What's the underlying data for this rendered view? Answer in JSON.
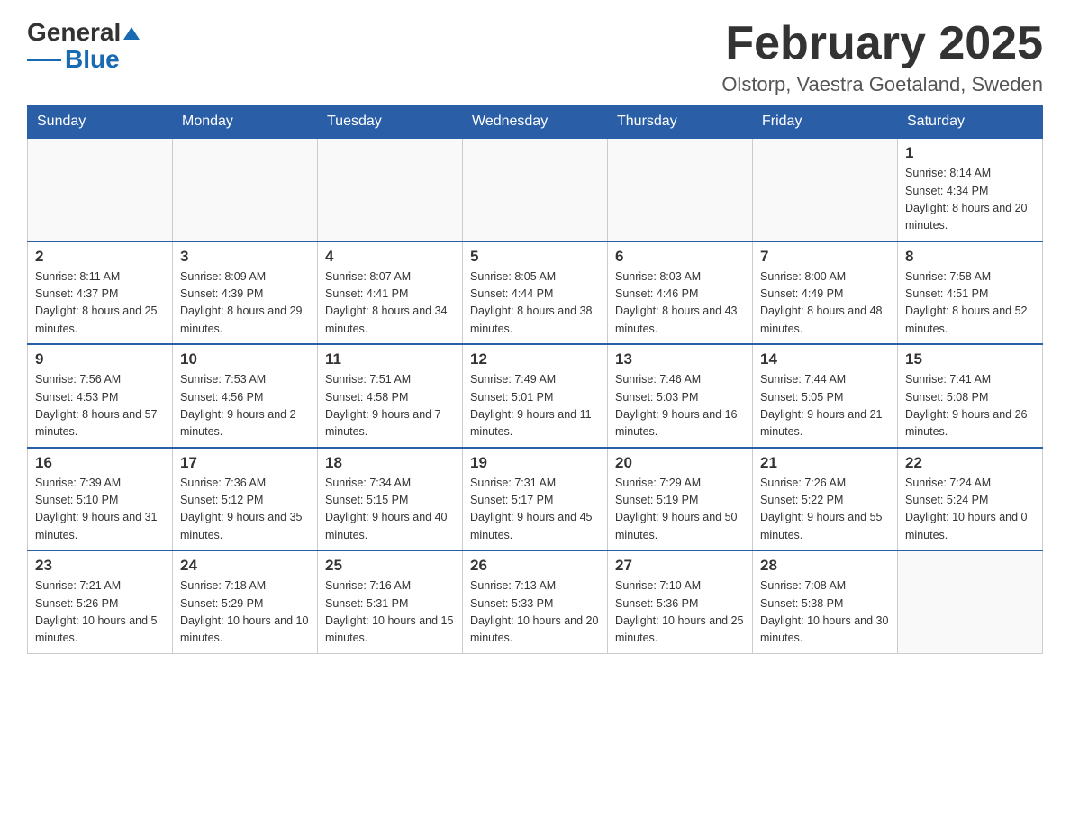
{
  "logo": {
    "general": "General",
    "blue": "Blue"
  },
  "header": {
    "title": "February 2025",
    "location": "Olstorp, Vaestra Goetaland, Sweden"
  },
  "weekdays": [
    "Sunday",
    "Monday",
    "Tuesday",
    "Wednesday",
    "Thursday",
    "Friday",
    "Saturday"
  ],
  "weeks": [
    [
      {
        "day": "",
        "info": ""
      },
      {
        "day": "",
        "info": ""
      },
      {
        "day": "",
        "info": ""
      },
      {
        "day": "",
        "info": ""
      },
      {
        "day": "",
        "info": ""
      },
      {
        "day": "",
        "info": ""
      },
      {
        "day": "1",
        "info": "Sunrise: 8:14 AM\nSunset: 4:34 PM\nDaylight: 8 hours and 20 minutes."
      }
    ],
    [
      {
        "day": "2",
        "info": "Sunrise: 8:11 AM\nSunset: 4:37 PM\nDaylight: 8 hours and 25 minutes."
      },
      {
        "day": "3",
        "info": "Sunrise: 8:09 AM\nSunset: 4:39 PM\nDaylight: 8 hours and 29 minutes."
      },
      {
        "day": "4",
        "info": "Sunrise: 8:07 AM\nSunset: 4:41 PM\nDaylight: 8 hours and 34 minutes."
      },
      {
        "day": "5",
        "info": "Sunrise: 8:05 AM\nSunset: 4:44 PM\nDaylight: 8 hours and 38 minutes."
      },
      {
        "day": "6",
        "info": "Sunrise: 8:03 AM\nSunset: 4:46 PM\nDaylight: 8 hours and 43 minutes."
      },
      {
        "day": "7",
        "info": "Sunrise: 8:00 AM\nSunset: 4:49 PM\nDaylight: 8 hours and 48 minutes."
      },
      {
        "day": "8",
        "info": "Sunrise: 7:58 AM\nSunset: 4:51 PM\nDaylight: 8 hours and 52 minutes."
      }
    ],
    [
      {
        "day": "9",
        "info": "Sunrise: 7:56 AM\nSunset: 4:53 PM\nDaylight: 8 hours and 57 minutes."
      },
      {
        "day": "10",
        "info": "Sunrise: 7:53 AM\nSunset: 4:56 PM\nDaylight: 9 hours and 2 minutes."
      },
      {
        "day": "11",
        "info": "Sunrise: 7:51 AM\nSunset: 4:58 PM\nDaylight: 9 hours and 7 minutes."
      },
      {
        "day": "12",
        "info": "Sunrise: 7:49 AM\nSunset: 5:01 PM\nDaylight: 9 hours and 11 minutes."
      },
      {
        "day": "13",
        "info": "Sunrise: 7:46 AM\nSunset: 5:03 PM\nDaylight: 9 hours and 16 minutes."
      },
      {
        "day": "14",
        "info": "Sunrise: 7:44 AM\nSunset: 5:05 PM\nDaylight: 9 hours and 21 minutes."
      },
      {
        "day": "15",
        "info": "Sunrise: 7:41 AM\nSunset: 5:08 PM\nDaylight: 9 hours and 26 minutes."
      }
    ],
    [
      {
        "day": "16",
        "info": "Sunrise: 7:39 AM\nSunset: 5:10 PM\nDaylight: 9 hours and 31 minutes."
      },
      {
        "day": "17",
        "info": "Sunrise: 7:36 AM\nSunset: 5:12 PM\nDaylight: 9 hours and 35 minutes."
      },
      {
        "day": "18",
        "info": "Sunrise: 7:34 AM\nSunset: 5:15 PM\nDaylight: 9 hours and 40 minutes."
      },
      {
        "day": "19",
        "info": "Sunrise: 7:31 AM\nSunset: 5:17 PM\nDaylight: 9 hours and 45 minutes."
      },
      {
        "day": "20",
        "info": "Sunrise: 7:29 AM\nSunset: 5:19 PM\nDaylight: 9 hours and 50 minutes."
      },
      {
        "day": "21",
        "info": "Sunrise: 7:26 AM\nSunset: 5:22 PM\nDaylight: 9 hours and 55 minutes."
      },
      {
        "day": "22",
        "info": "Sunrise: 7:24 AM\nSunset: 5:24 PM\nDaylight: 10 hours and 0 minutes."
      }
    ],
    [
      {
        "day": "23",
        "info": "Sunrise: 7:21 AM\nSunset: 5:26 PM\nDaylight: 10 hours and 5 minutes."
      },
      {
        "day": "24",
        "info": "Sunrise: 7:18 AM\nSunset: 5:29 PM\nDaylight: 10 hours and 10 minutes."
      },
      {
        "day": "25",
        "info": "Sunrise: 7:16 AM\nSunset: 5:31 PM\nDaylight: 10 hours and 15 minutes."
      },
      {
        "day": "26",
        "info": "Sunrise: 7:13 AM\nSunset: 5:33 PM\nDaylight: 10 hours and 20 minutes."
      },
      {
        "day": "27",
        "info": "Sunrise: 7:10 AM\nSunset: 5:36 PM\nDaylight: 10 hours and 25 minutes."
      },
      {
        "day": "28",
        "info": "Sunrise: 7:08 AM\nSunset: 5:38 PM\nDaylight: 10 hours and 30 minutes."
      },
      {
        "day": "",
        "info": ""
      }
    ]
  ]
}
